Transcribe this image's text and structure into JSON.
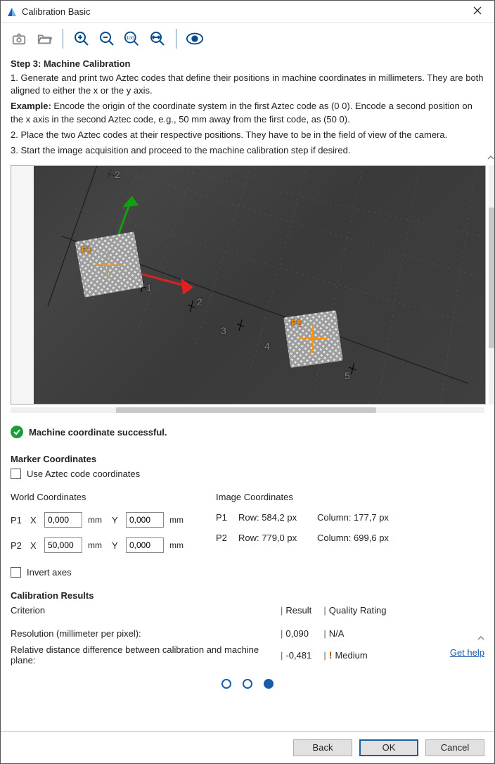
{
  "window": {
    "title": "Calibration Basic"
  },
  "step": {
    "heading": "Step 3: Machine Calibration",
    "line1": "1. Generate and print two Aztec codes that define their positions in machine coordinates in millimeters. They are both aligned to either the x or the y axis.",
    "example_label": "Example:",
    "example_text": " Encode the origin of the coordinate system in the first Aztec code as (0 0). Encode a second position on the x axis in the second Aztec code, e.g., 50 mm away from the first code, as (50 0).",
    "line2": "2. Place the two Aztec codes at their respective positions. They have to be in the field of view of the camera.",
    "line3": "3. Start the image acquisition and proceed to the machine calibration step if desired."
  },
  "image_ticks": {
    "t1": "1",
    "t2": "2",
    "t3": "3",
    "t4": "4",
    "t5": "5"
  },
  "markers": {
    "p1": "P1",
    "p2": "P2"
  },
  "status": {
    "text": "Machine coordinate successful."
  },
  "marker_coords": {
    "heading": "Marker Coordinates",
    "chk_label": "Use Aztec code coordinates",
    "world_head": "World Coordinates",
    "image_head": "Image Coordinates",
    "P1": "P1",
    "P2": "P2",
    "X": "X",
    "Y": "Y",
    "mm": "mm",
    "p1x": "0,000",
    "p1y": "0,000",
    "p2x": "50,000",
    "p2y": "0,000",
    "p1_row_label": "Row:",
    "p1_row": "584,2 px",
    "p1_col_label": "Column:",
    "p1_col": "177,7 px",
    "p2_row_label": "Row:",
    "p2_row": "779,0 px",
    "p2_col_label": "Column:",
    "p2_col": "699,6 px",
    "invert_label": "Invert axes"
  },
  "results": {
    "heading": "Calibration Results",
    "criterion_h": "Criterion",
    "result_h": "Result",
    "quality_h": "Quality Rating",
    "row1_c": "Resolution (millimeter per pixel):",
    "row1_v": "0,090",
    "row1_q": "N/A",
    "row2_c": "Relative distance difference between calibration and machine plane:",
    "row2_v": "-0,481",
    "row2_q": "Medium"
  },
  "help": {
    "get_help": "Get help"
  },
  "footer": {
    "back": "Back",
    "ok": "OK",
    "cancel": "Cancel"
  },
  "separator": "|"
}
